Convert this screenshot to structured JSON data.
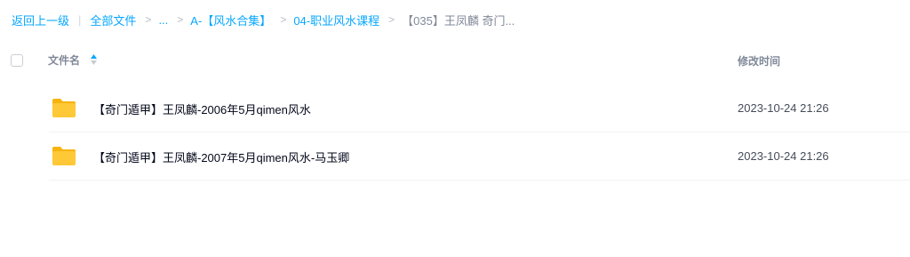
{
  "breadcrumb": {
    "back": "返回上一级",
    "divider": "|",
    "all_files": "全部文件",
    "separator": ">",
    "ellipsis": "...",
    "level1": "A-【风水合集】",
    "level2": "04-职业风水课程",
    "current": "【035】王凤麟 奇门..."
  },
  "table": {
    "column_name": "文件名",
    "column_time": "修改时间",
    "sort_icon": "sort-updown-icon",
    "rows": [
      {
        "icon": "folder-icon",
        "name": "【奇门遁甲】王凤麟-2006年5月qimen风水",
        "modified": "2023-10-24 21:26"
      },
      {
        "icon": "folder-icon",
        "name": "【奇门遁甲】王凤麟-2007年5月qimen风水-马玉卿",
        "modified": "2023-10-24 21:26"
      }
    ]
  },
  "colors": {
    "accent": "#06a7ff",
    "folder": "#ffc837",
    "folder_tab": "#f6b40c"
  }
}
